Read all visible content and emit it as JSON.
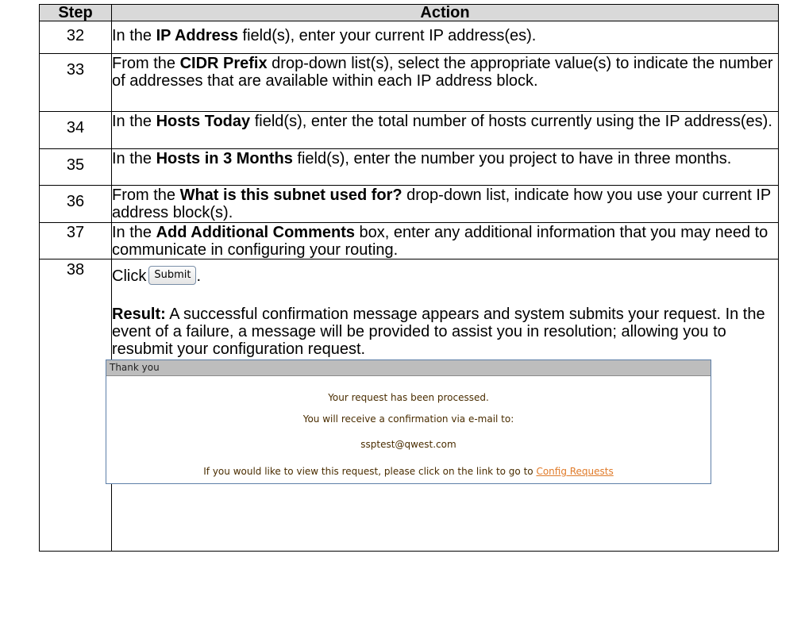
{
  "headers": {
    "step": "Step",
    "action": "Action"
  },
  "rows": [
    {
      "step": "32",
      "pre": "In the ",
      "bold": "IP Address",
      "post": " field(s), enter your current IP address(es)."
    },
    {
      "step": "33",
      "pre": "From the ",
      "bold": "CIDR Prefix",
      "post": " drop-down list(s), select the appropriate value(s) to indicate the number of addresses that are available within each IP address block."
    },
    {
      "step": "34",
      "pre": "In the ",
      "bold": "Hosts Today",
      "post": " field(s), enter the total number of hosts currently using the IP address(es)."
    },
    {
      "step": "35",
      "pre": "In the ",
      "bold": "Hosts in 3 Months",
      "post": " field(s), enter the number you project to have in three months."
    },
    {
      "step": "36",
      "pre": "From the ",
      "bold": "What is this subnet used for?",
      "post": " drop-down list, indicate how you use your current IP address block(s)."
    },
    {
      "step": "37",
      "pre": "In the ",
      "bold": "Add Additional Comments",
      "post": " box, enter any additional information that you may need to communicate in configuring your routing."
    }
  ],
  "last_step": {
    "step": "38",
    "click_prefix": "Click",
    "button_label": "Submit",
    "click_suffix": ".",
    "result_label": "Result:",
    "result_text": "  A successful confirmation message appears and system submits your request.  In the event of a failure, a message will be provided to assist you in resolution; allowing you to resubmit your configuration request."
  },
  "confirmation_panel": {
    "title": "Thank you",
    "line1": "Your request has been processed.",
    "line2": "You will receive a confirmation via e-mail to:",
    "email": "ssptest@qwest.com",
    "line4_prefix": "If you would like to view this request, please click on the link to go to ",
    "link_label": "Config Requests"
  }
}
